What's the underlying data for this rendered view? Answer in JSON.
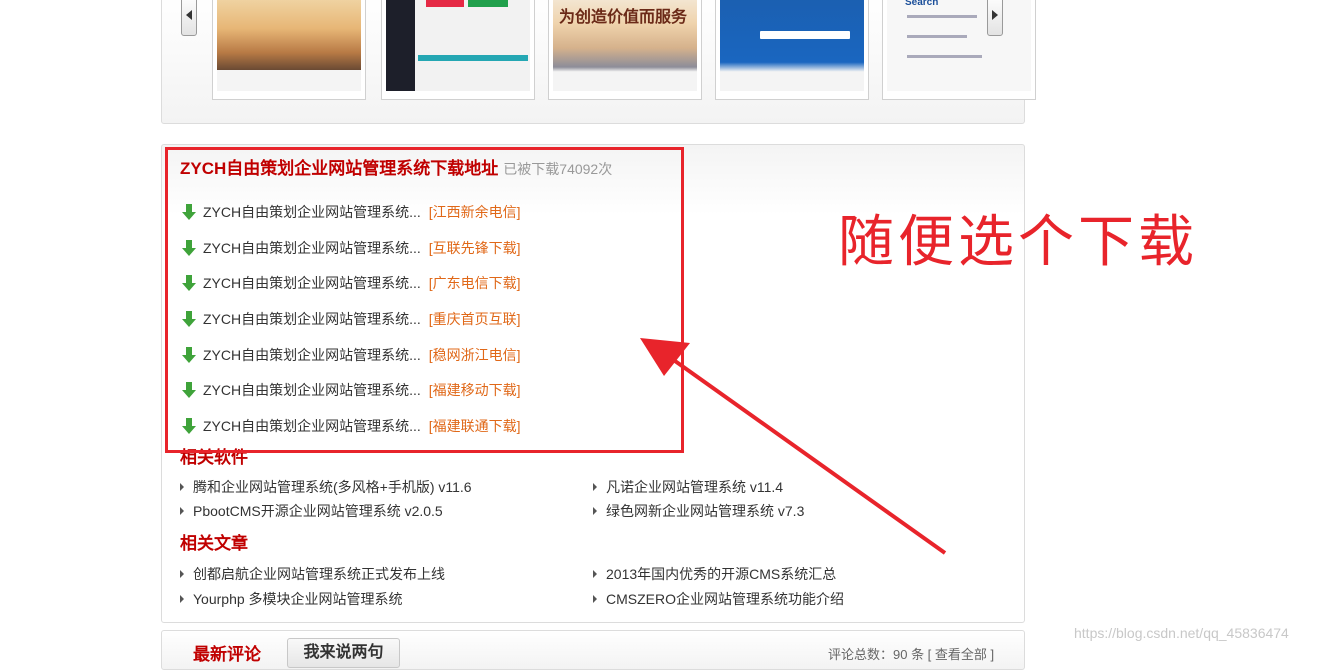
{
  "download": {
    "title": "ZYCH自由策划企业网站管理系统下载地址",
    "count": "已被下载74092次",
    "items": [
      {
        "name": "ZYCH自由策划企业网站管理系统...",
        "source": "[江西新余电信]"
      },
      {
        "name": "ZYCH自由策划企业网站管理系统...",
        "source": "[互联先锋下载]"
      },
      {
        "name": "ZYCH自由策划企业网站管理系统...",
        "source": "[广东电信下载]"
      },
      {
        "name": "ZYCH自由策划企业网站管理系统...",
        "source": "[重庆首页互联]"
      },
      {
        "name": "ZYCH自由策划企业网站管理系统...",
        "source": "[稳网浙江电信]"
      },
      {
        "name": "ZYCH自由策划企业网站管理系统...",
        "source": "[福建移动下载]"
      },
      {
        "name": "ZYCH自由策划企业网站管理系统...",
        "source": "[福建联通下载]"
      }
    ]
  },
  "related_software": {
    "title": "相关软件",
    "items": [
      "腾和企业网站管理系统(多风格+手机版) v11.6",
      "凡诺企业网站管理系统 v11.4",
      "PbootCMS开源企业网站管理系统 v2.0.5",
      "绿色网新企业网站管理系统 v7.3"
    ]
  },
  "related_articles": {
    "title": "相关文章",
    "items": [
      "创都启航企业网站管理系统正式发布上线",
      "2013年国内优秀的开源CMS系统汇总",
      "Yourphp 多模块企业网站管理系统",
      "CMSZERO企业网站管理系统功能介绍"
    ]
  },
  "annotation": "随便选个下载",
  "comments": {
    "title": "最新评论",
    "button": "我来说两句",
    "count": "评论总数：90 条 [ 查看全部 ]"
  },
  "watermark": "https://blog.csdn.net/qq_45836474",
  "thumb_snippets": {
    "t3_text": "为创造价值而服务",
    "t5_text": "Search"
  },
  "colors": {
    "accent_red": "#c00000",
    "source_orange": "#e06818",
    "annotation_red": "#e8242b",
    "download_green": "#3fa33a"
  }
}
